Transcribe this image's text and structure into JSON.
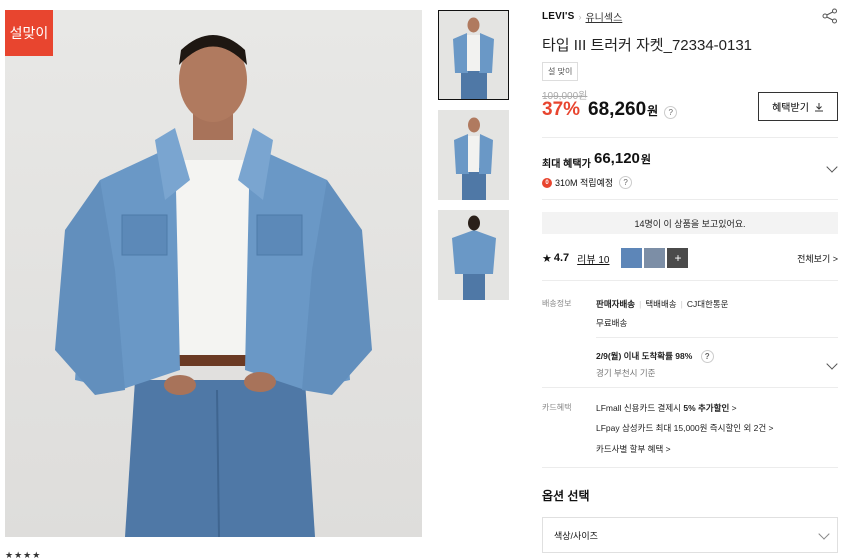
{
  "badge": "설맞이",
  "brand": {
    "name": "LEVI'S",
    "category": "유니섹스"
  },
  "product": {
    "title": "타입 III 트러커 자켓_72334-0131",
    "tag": "설 맞이",
    "original_price": "109,000원",
    "discount": "37%",
    "price": "68,260",
    "won": "원",
    "coupon_button": "혜택받기"
  },
  "benefit": {
    "label": "최대 혜택가",
    "price": "66,120",
    "won": "원",
    "points_icon": "0",
    "points": "310M 적립예정"
  },
  "viewers": "14명이 이 상품을 보고있어요.",
  "reviews": {
    "rating": "4.7",
    "review_label": "리뷰 10",
    "more": "+",
    "view_all": "전체보기 >"
  },
  "shipping": {
    "label": "배송정보",
    "seller": "판매자배송",
    "type": "택배배송",
    "carrier": "CJ대한통운",
    "fee": "무료배송",
    "arrival": "2/9(월) 이내 도착확률 98%",
    "arrival_note": "경기 부천시 기준"
  },
  "card": {
    "label": "카드혜택",
    "line1_prefix": "LFmall 신용카드 결제시",
    "line1_bold": "5% 추가할인",
    "line1_suffix": ">",
    "line2": "LFpay 삼성카드 최대 15,000원 즉시할인 외 2건 >",
    "line3": "카드사별 할부 혜택 >"
  },
  "options": {
    "title": "옵션 선택",
    "select_placeholder": "색상/사이즈"
  },
  "qmark": "?",
  "colors": {
    "accent_red": "#e8452f",
    "denim": "#5b85b3"
  }
}
